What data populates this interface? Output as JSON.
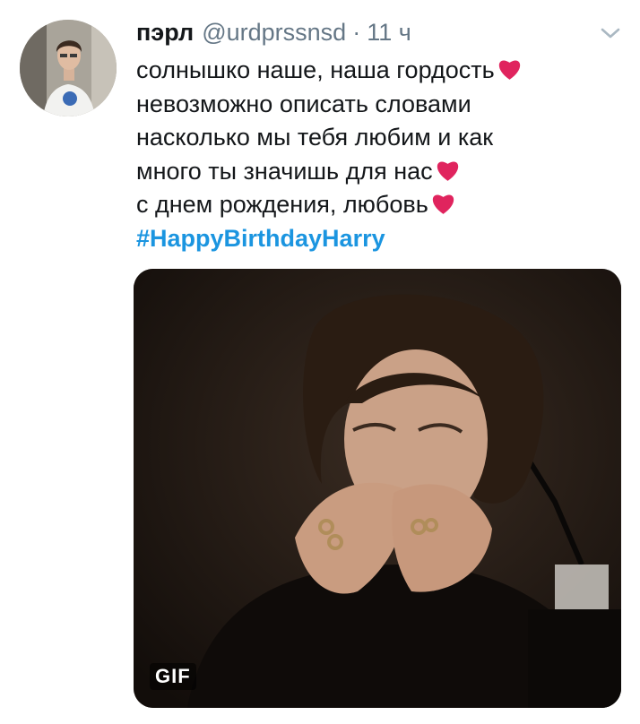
{
  "tweet": {
    "user": {
      "display_name": "пэрл",
      "handle": "@urdprssnsd",
      "separator": "·",
      "time": "11 ч"
    },
    "lines": [
      "солнышко наше, наша гордость",
      "невозможно описать словами",
      "насколько мы тебя любим и как",
      "много ты значишь для нас",
      "с днем рождения, любовь"
    ],
    "hashtag": "#HappyBirthdayHarry",
    "media": {
      "badge": "GIF"
    },
    "colors": {
      "accent": "#1b95e0",
      "heart": "#e0245e",
      "text": "#14171a",
      "muted": "#657786"
    },
    "icons": [
      "chevron-down-icon",
      "heart-icon"
    ]
  }
}
